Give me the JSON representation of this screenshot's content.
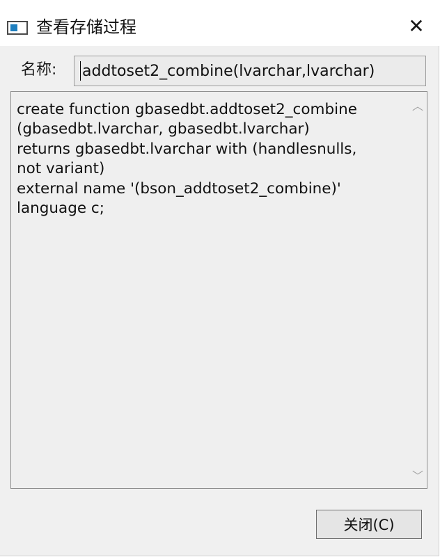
{
  "window": {
    "title": "查看存储过程",
    "close_icon": "close-icon"
  },
  "name_row": {
    "label": "名称:",
    "value": "addtoset2_combine(lvarchar,lvarchar)"
  },
  "text_area": {
    "content": "create function gbasedbt.addtoset2_combine\n(gbasedbt.lvarchar, gbasedbt.lvarchar)\nreturns gbasedbt.lvarchar with (handlesnulls,\nnot variant)\nexternal name '(bson_addtoset2_combine)'\nlanguage c;",
    "scroll_up_icon": "chevron-up-icon",
    "scroll_down_icon": "chevron-down-icon"
  },
  "buttons": {
    "close_label": "关闭(C)"
  }
}
